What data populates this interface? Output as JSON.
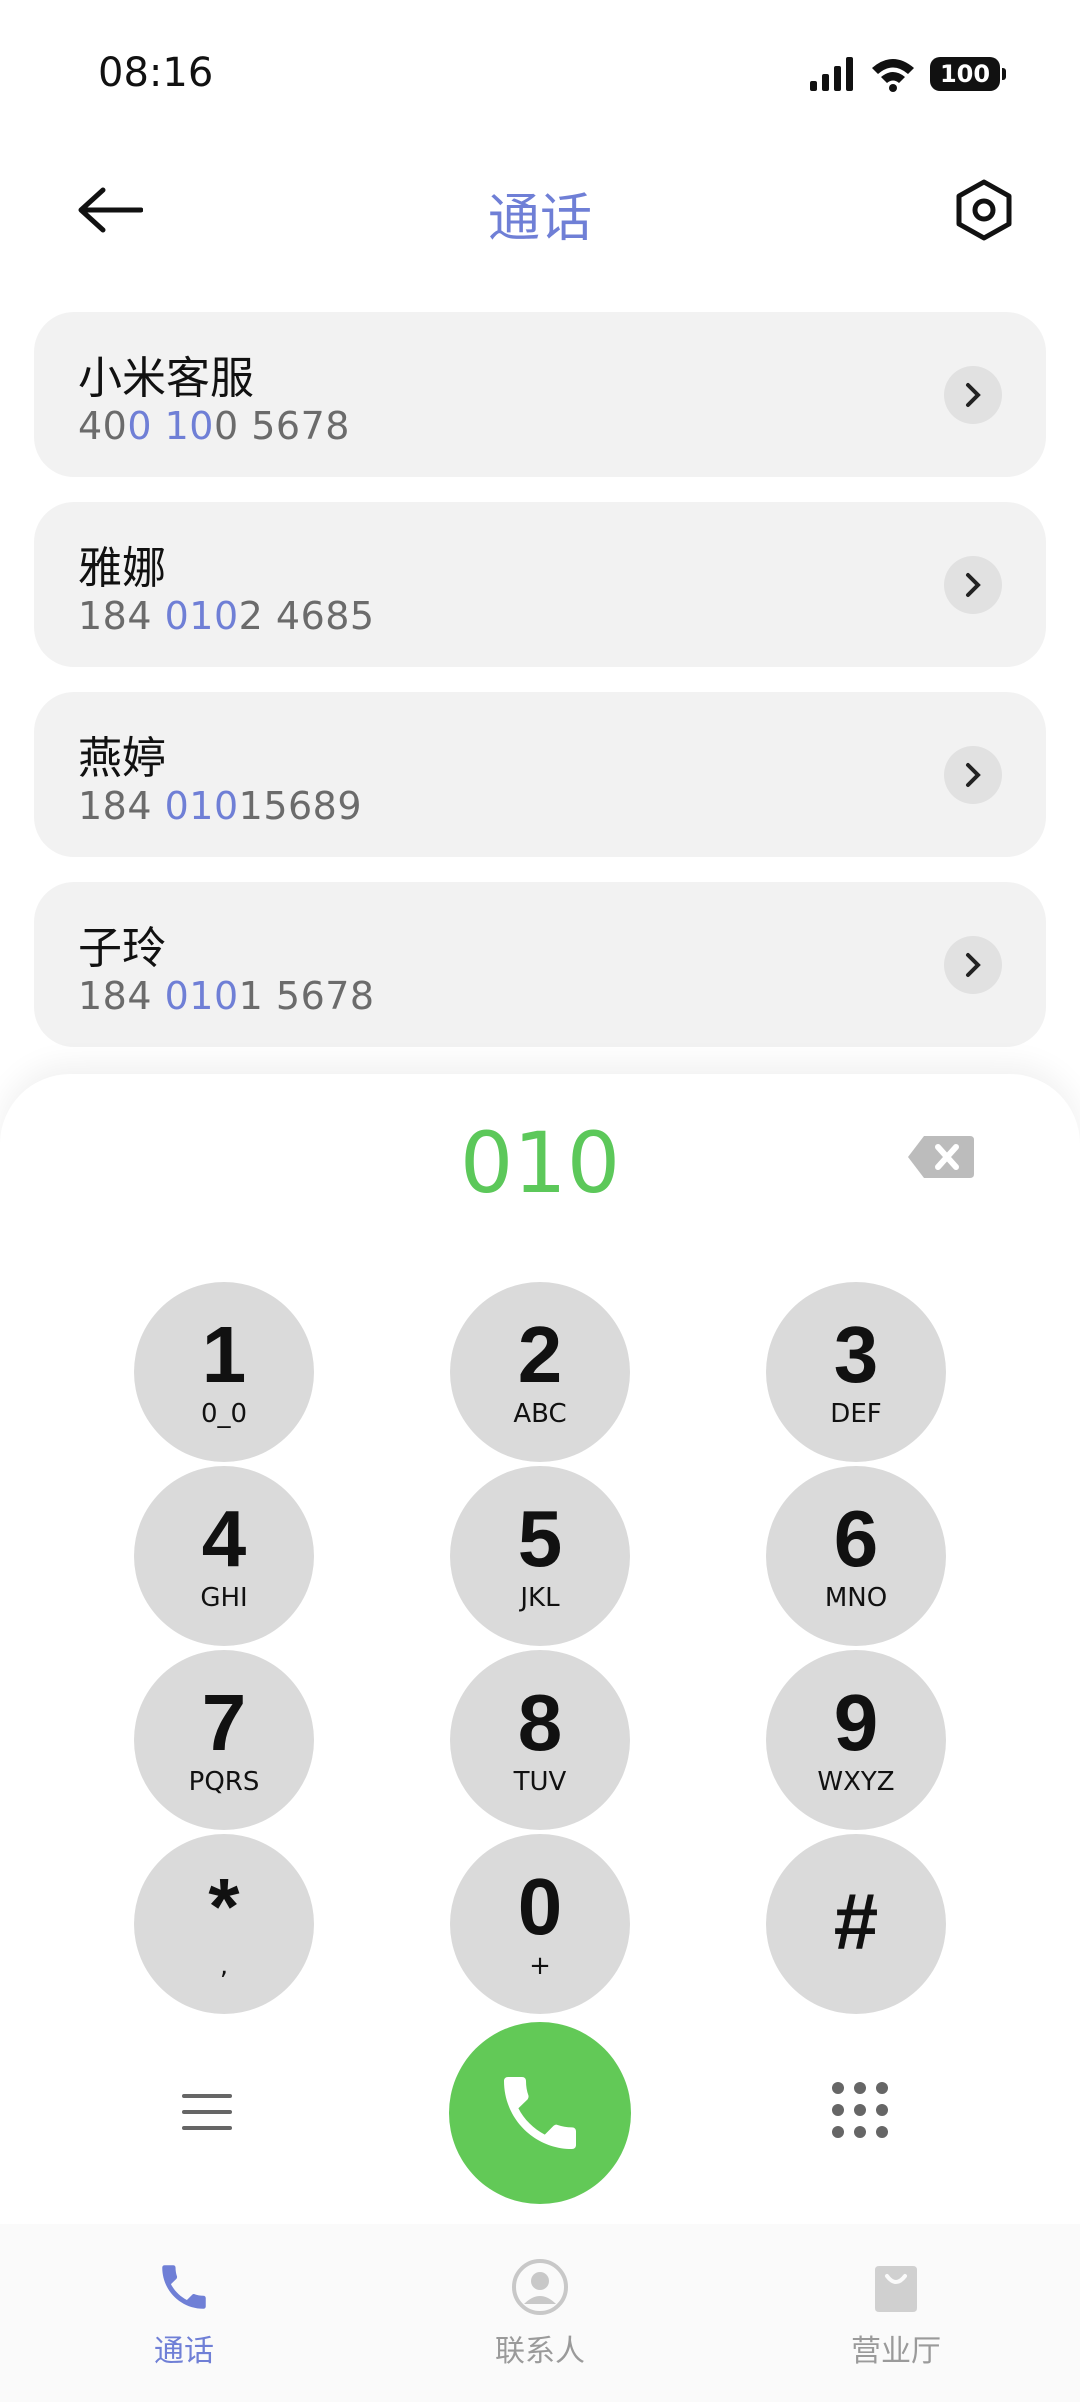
{
  "status_bar": {
    "time": "08:16",
    "battery": "100"
  },
  "header": {
    "title": "通话"
  },
  "contacts": [
    {
      "name": "小米客服",
      "number_parts": [
        "40",
        "0 10",
        "0 5678"
      ]
    },
    {
      "name": "雅娜",
      "number_parts": [
        "184 ",
        "010",
        "2 4685"
      ]
    },
    {
      "name": "燕婷",
      "number_parts": [
        "184 ",
        "010",
        "15689"
      ]
    },
    {
      "name": "子玲",
      "number_parts": [
        "184 ",
        "010",
        "1 5678"
      ]
    }
  ],
  "dialer": {
    "input": "010",
    "keys": [
      {
        "digit": "1",
        "letters": "0_0"
      },
      {
        "digit": "2",
        "letters": "ABC"
      },
      {
        "digit": "3",
        "letters": "DEF"
      },
      {
        "digit": "4",
        "letters": "GHI"
      },
      {
        "digit": "5",
        "letters": "JKL"
      },
      {
        "digit": "6",
        "letters": "MNO"
      },
      {
        "digit": "7",
        "letters": "PQRS"
      },
      {
        "digit": "8",
        "letters": "TUV"
      },
      {
        "digit": "9",
        "letters": "WXYZ"
      },
      {
        "digit": "*",
        "letters": ","
      },
      {
        "digit": "0",
        "letters": "+"
      },
      {
        "digit": "#",
        "letters": ""
      }
    ]
  },
  "bottom_nav": [
    {
      "label": "通话",
      "icon": "phone-icon",
      "active": true
    },
    {
      "label": "联系人",
      "icon": "person-icon",
      "active": false
    },
    {
      "label": "营业厅",
      "icon": "shopping-bag-icon",
      "active": false
    }
  ],
  "colors": {
    "accent": "#6f7fd6",
    "call_green": "#62c957",
    "dial_text": "#5cc85a"
  }
}
